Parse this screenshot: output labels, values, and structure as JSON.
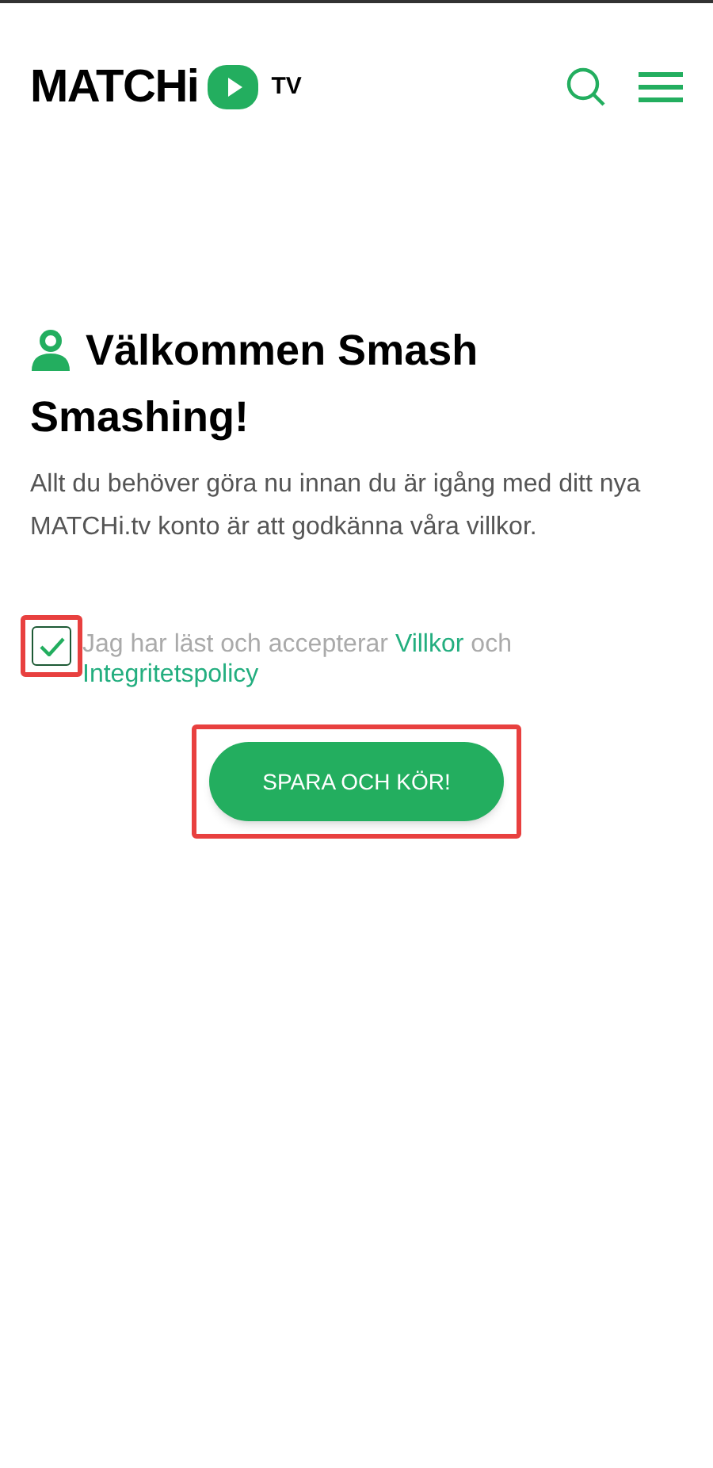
{
  "header": {
    "logo_text": "MATCHi",
    "logo_suffix": "TV"
  },
  "welcome": {
    "title": "Välkommen Smash Smashing!",
    "intro": "Allt du behöver göra nu innan du är igång med ditt nya MATCHi.tv konto är att godkänna våra villkor."
  },
  "consent": {
    "checked": true,
    "highlighted": true,
    "text_before": "Jag har läst och accepterar",
    "terms_link": "Villkor",
    "text_middle": "och",
    "privacy_link": "Integritetspolicy"
  },
  "submit": {
    "label": "SPARA OCH KÖR!",
    "highlighted": true
  }
}
